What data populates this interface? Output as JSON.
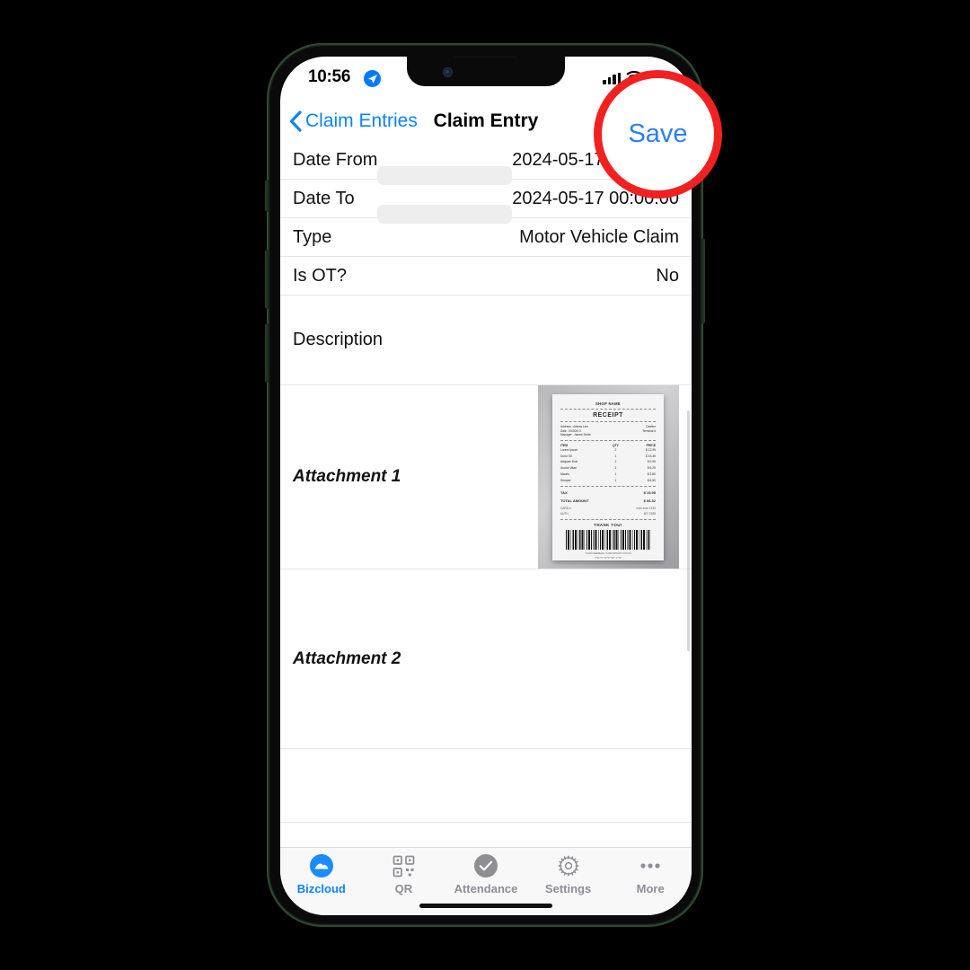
{
  "status_bar": {
    "time": "10:56",
    "location_icon": "location-arrow-icon",
    "cellular_icon": "cellular-bars-icon",
    "wifi_icon": "wifi-icon",
    "battery_icon": "battery-icon"
  },
  "nav": {
    "back_label": "Claim Entries",
    "back_icon": "chevron-left-icon",
    "title": "Claim Entry",
    "save_label": "Save"
  },
  "form": {
    "rows": [
      {
        "label": "Date From",
        "value": "2024-05-17 00:00:00",
        "has_date_pill": true
      },
      {
        "label": "Date To",
        "value": "2024-05-17 00:00:00",
        "has_date_pill": true
      },
      {
        "label": "Type",
        "value": "Motor Vehicle Claim",
        "has_date_pill": false
      },
      {
        "label": "Is OT?",
        "value": "No",
        "has_date_pill": false
      }
    ],
    "description_label": "Description",
    "description_value": "",
    "attachment1_label": "Attachment 1",
    "attachment2_label": "Attachment 2"
  },
  "receipt": {
    "shop_name": "SHOP NAME",
    "heading": "RECEIPT",
    "address_label": "Address : Adress Line",
    "date_label": "Date : 00/00/0 0",
    "manager_label": "Manager : James Smith",
    "cashier_label": "Cashier",
    "terminal_label": "Terminal #",
    "columns": [
      "ITEM",
      "QTY",
      "PRICE"
    ],
    "items": [
      {
        "name": "Lorem Ipsum",
        "qty": "2",
        "price": "$ 12.99"
      },
      {
        "name": "Dolor Sit",
        "qty": "1",
        "price": "$ 15.49"
      },
      {
        "name": "Aliquam Erat",
        "qty": "2",
        "price": "$ 9.99"
      },
      {
        "name": "Auctor Vitae",
        "qty": "1",
        "price": "$ 6.25"
      },
      {
        "name": "Mauris",
        "qty": "1",
        "price": "$ 3.80"
      },
      {
        "name": "Semper",
        "qty": "1",
        "price": "$ 6.50"
      }
    ],
    "tax_label": "TAX",
    "tax_value": "$ 15.95",
    "total_label": "TOTAL AMOUNT",
    "total_value": "$ 66.32",
    "card_label": "CARD #",
    "card_value": "xxxx xxxx 1234",
    "auth_label": "AUTH",
    "auth_value": "607 2355",
    "thanks": "THANK YOU!",
    "footer_line1": "YOUR FEEDBACK IS IMPORTANT FOR US",
    "footer_line2": "WWW.SHOPNAME.COM"
  },
  "tabbar": {
    "items": [
      {
        "label": "Bizcloud",
        "icon": "cloud-icon",
        "active": true
      },
      {
        "label": "QR",
        "icon": "qr-code-icon",
        "active": false
      },
      {
        "label": "Attendance",
        "icon": "check-circle-icon",
        "active": false
      },
      {
        "label": "Settings",
        "icon": "gear-icon",
        "active": false
      },
      {
        "label": "More",
        "icon": "ellipsis-icon",
        "active": false
      }
    ]
  },
  "annotation": {
    "shape": "circle-highlight",
    "color": "#f22121",
    "target_label": "Save"
  },
  "colors": {
    "accent_blue": "#0a84ff",
    "save_blue": "#2d7ff0",
    "annotation_red": "#f22121",
    "tab_inactive": "#8e8e93",
    "separator": "#e6e6e6",
    "tabbar_bg": "#f8f8f9"
  }
}
